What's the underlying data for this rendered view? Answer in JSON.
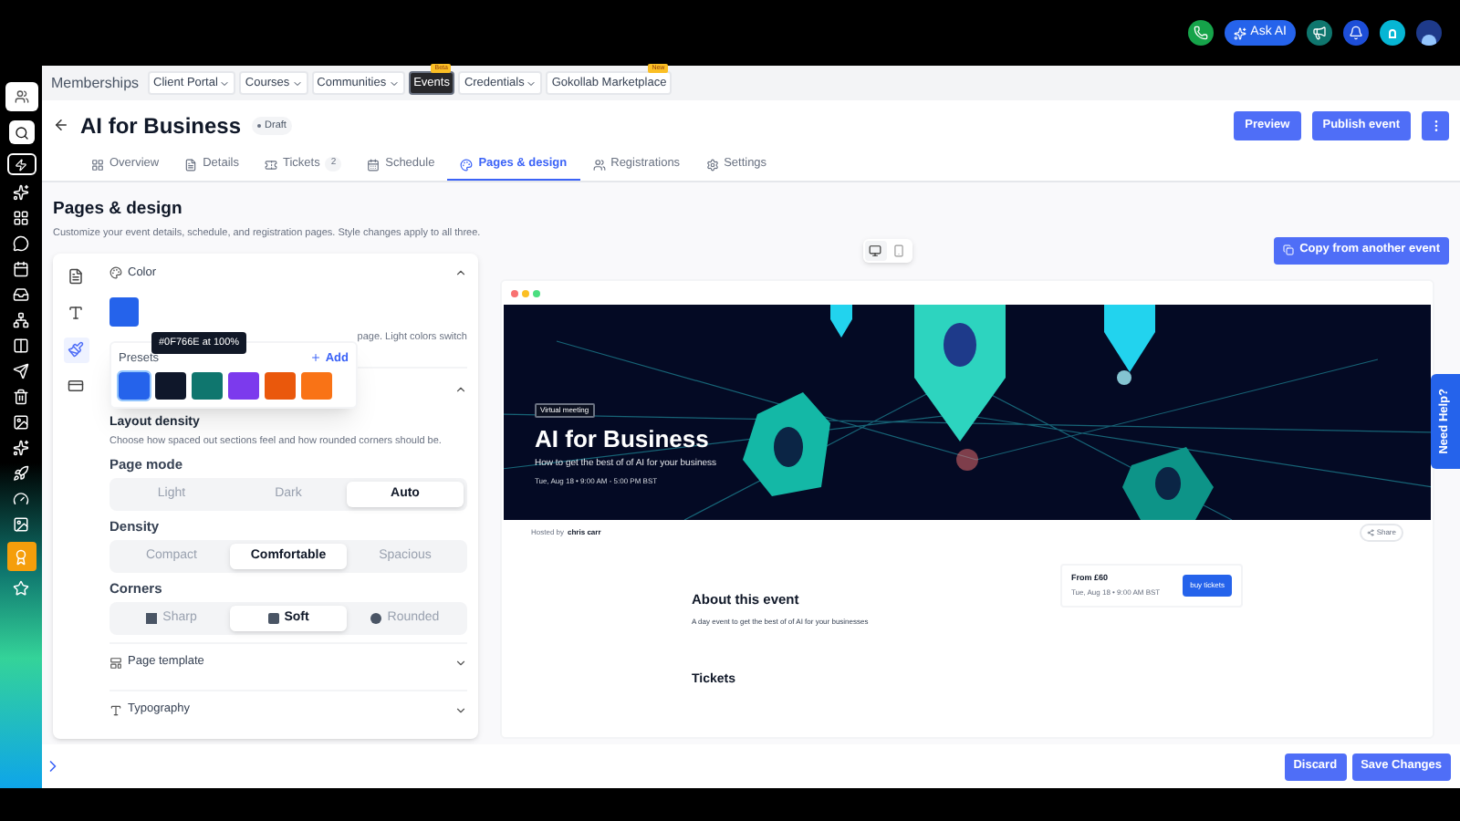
{
  "topbar": {
    "ask_ai": "Ask AI"
  },
  "nav": {
    "title": "Memberships",
    "items": [
      {
        "label": "Client Portal",
        "dropdown": true,
        "selected": false
      },
      {
        "label": "Courses",
        "dropdown": true,
        "selected": false
      },
      {
        "label": "Communities",
        "dropdown": true,
        "selected": false
      },
      {
        "label": "Events",
        "dropdown": false,
        "selected": true,
        "badge": "Beta"
      },
      {
        "label": "Credentials",
        "dropdown": true,
        "selected": false
      },
      {
        "label": "Gokollab Marketplace",
        "dropdown": false,
        "selected": false,
        "badge": "New"
      }
    ]
  },
  "header": {
    "title": "AI for Business",
    "status": "Draft",
    "buttons": [
      "Preview",
      "Publish event"
    ]
  },
  "tabs": [
    {
      "label": "Overview",
      "selected": false
    },
    {
      "label": "Details",
      "selected": false
    },
    {
      "label": "Tickets",
      "selected": false,
      "count": "2"
    },
    {
      "label": "Schedule",
      "selected": false
    },
    {
      "label": "Pages & design",
      "selected": true
    },
    {
      "label": "Registrations",
      "selected": false
    },
    {
      "label": "Settings",
      "selected": false
    }
  ],
  "page": {
    "title": "Pages & design",
    "subtitle": "Customize your event details, schedule, and registration pages. Style changes apply to all three."
  },
  "editor": {
    "tools": [
      {
        "selected": false
      },
      {
        "selected": false
      },
      {
        "selected": true
      },
      {
        "selected": false
      }
    ],
    "color": {
      "title": "Color",
      "expanded": true,
      "swatch": {
        "color": "#2563eb"
      },
      "hint": "page. Light colors switch",
      "presets": {
        "title": "Presets",
        "add": "Add",
        "tooltip": "#0F766E at 100%",
        "items": [
          {
            "color": "#2563eb",
            "selected": true
          },
          {
            "color": "#0f172a",
            "selected": false
          },
          {
            "color": "#0f766e",
            "selected": false
          },
          {
            "color": "#7c3aed",
            "selected": false
          },
          {
            "color": "#ea580c",
            "selected": false
          },
          {
            "color": "#f97316",
            "selected": false
          }
        ]
      }
    },
    "layout": {
      "expanded": true,
      "title": "Layout density",
      "description": "Choose how spaced out sections feel and how rounded corners should be.",
      "groups": [
        {
          "label": "Page mode",
          "options": [
            {
              "label": "Light",
              "selected": false
            },
            {
              "label": "Dark",
              "selected": false
            },
            {
              "label": "Auto",
              "selected": true
            }
          ]
        },
        {
          "label": "Density",
          "options": [
            {
              "label": "Compact",
              "selected": false
            },
            {
              "label": "Comfortable",
              "selected": true
            },
            {
              "label": "Spacious",
              "selected": false
            }
          ]
        },
        {
          "label": "Corners",
          "kind": "icons",
          "options": [
            {
              "label": "Sharp",
              "selected": false
            },
            {
              "label": "Soft",
              "selected": true
            },
            {
              "label": "Rounded",
              "selected": false
            }
          ]
        }
      ]
    },
    "sections": [
      {
        "title": "Page template",
        "expanded": false
      },
      {
        "title": "Typography",
        "expanded": false
      }
    ]
  },
  "preview": {
    "devices": [
      {
        "selected": true
      },
      {
        "selected": false
      }
    ],
    "copy_button": "Copy from another event",
    "hero": {
      "tag": "Virtual meeting",
      "title": "AI for Business",
      "subtitle": "How to get the best of of AI for your business",
      "datetime": "Tue, Aug 18 • 9:00 AM - 5:00 PM BST"
    },
    "hosted_label": "Hosted by",
    "host": "chris carr",
    "share": "Share",
    "about": {
      "title": "About this event",
      "text": "A day event to get the best of of AI for your businesses"
    },
    "price_card": {
      "price": "From £60",
      "date": "Tue, Aug 18 • 9:00 AM BST",
      "button": "buy tickets"
    },
    "tickets_title": "Tickets"
  },
  "help": "Need Help?",
  "footer": {
    "buttons": [
      "Discard",
      "Save Changes"
    ]
  }
}
